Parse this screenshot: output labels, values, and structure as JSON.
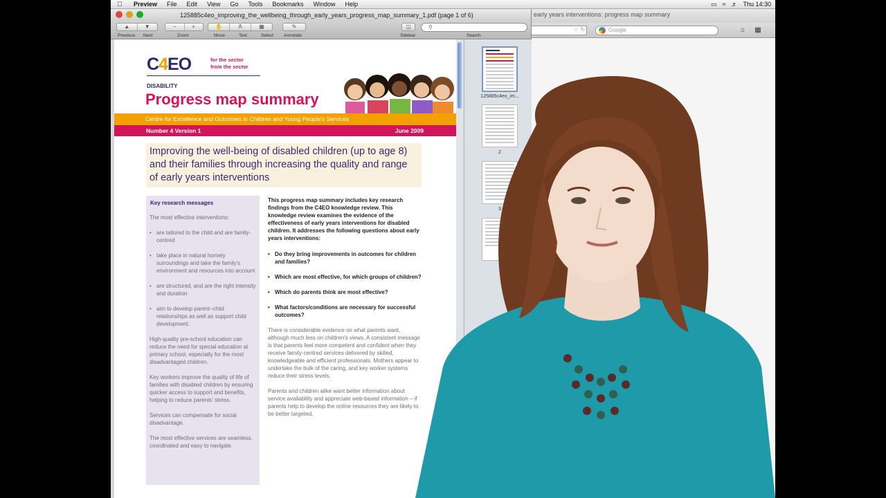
{
  "menubar": {
    "items": [
      "Preview",
      "File",
      "Edit",
      "View",
      "Go",
      "Tools",
      "Bookmarks",
      "Window",
      "Help"
    ],
    "clock": "Thu 14:30"
  },
  "browser": {
    "title": "f early years interventions: progress map summary",
    "search_placeholder": "Google"
  },
  "preview": {
    "window_title": "125885c4eo_improving_the_wellbeing_through_early_years_progress_map_summary_1.pdf (page 1 of 6)",
    "toolbar": {
      "previous": "Previous",
      "next": "Next",
      "zoom": "Zoom",
      "move": "Move",
      "text": "Text",
      "select": "Select",
      "annotate": "Annotate",
      "sidebar": "Sidebar",
      "search": "Search"
    },
    "thumbnails": [
      "125885c4eo_im...",
      "2",
      "3"
    ]
  },
  "document": {
    "logo_c": "C",
    "logo_4": "4",
    "logo_eo": "EO",
    "logo_tag_1": "for the sector",
    "logo_tag_2": "from the sector",
    "category": "DISABILITY",
    "title": "Progress map summary",
    "centre": "Centre for Excellence and Outcomes in Children and Young People's Services",
    "number": "Number 4 Version 1",
    "date": "June 2009",
    "headline": "Improving the well-being of disabled children (up to age 8) and their families through increasing the quality and range of early years interventions",
    "left": {
      "heading": "Key research messages",
      "intro": "The most effective interventions:",
      "bullets": [
        "are tailored to the child and are family-centred",
        "take place in natural homely surroundings and take the family's environment and resources into account",
        "are structured, and are the right intensity and duration",
        "aim to develop parent–child relationships as well as support child development."
      ],
      "p1": "High-quality pre-school education can reduce the need for special education at primary school, especially for the most disadvantaged children.",
      "p2": "Key workers improve the quality of life of families with disabled children by ensuring quicker access to support and benefits, helping to reduce parents' stress.",
      "p3": "Services can compensate for social disadvantage.",
      "p4": "The most effective services are seamless, coordinated and easy to navigate."
    },
    "right": {
      "intro": "This progress map summary includes key research findings from the C4EO knowledge review. This knowledge review examines the evidence of the effectiveness of early years interventions for disabled children. It addresses the following questions about early years interventions:",
      "questions": [
        "Do they bring improvements in outcomes for children and families?",
        "Which are most effective, for which groups of children?",
        "Which do parents think are most effective?",
        "What factors/conditions are necessary for successful outcomes?"
      ],
      "p1": "There is considerable evidence on what parents want, although much less on children's views. A consistent message is that parents feel more competent and confident when they receive family-centred services delivered by skilled, knowledgeable and efficient professionals. Mothers appear to undertake the bulk of the caring, and key worker systems reduce their stress levels.",
      "p2": "Parents and children alike want better information about service availability and appreciate web-based information – if parents help to develop the online resources they are likely to be better targeted."
    }
  },
  "colors": {
    "brand_navy": "#2c2a6f",
    "brand_magenta": "#d4145a",
    "brand_orange": "#f2a100",
    "top_shirt": "#1f9aa8"
  }
}
